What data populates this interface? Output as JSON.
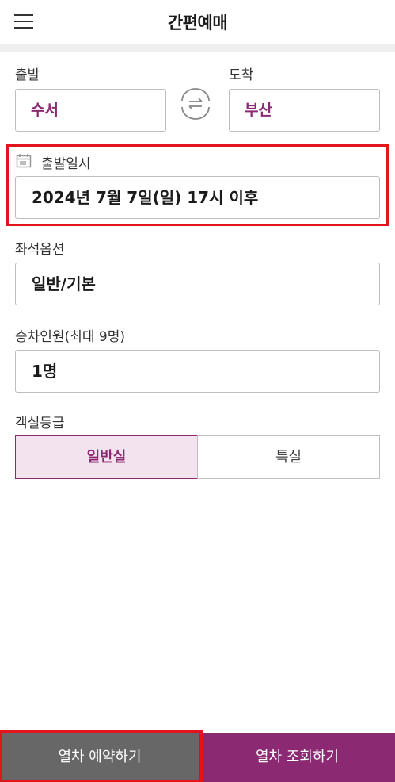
{
  "header": {
    "title": "간편예매",
    "menu_icon": "hamburger-menu-icon"
  },
  "departure": {
    "label": "출발",
    "value": "수서"
  },
  "arrival": {
    "label": "도착",
    "value": "부산"
  },
  "swap_icon": "swap-arrows-icon",
  "datetime": {
    "label": "출발일시",
    "icon": "calendar-icon",
    "value": "2024년 7월 7일(일) 17시 이후"
  },
  "seat_option": {
    "label": "좌석옵션",
    "value": "일반/기본"
  },
  "passengers": {
    "label": "승차인원(최대 9명)",
    "value": "1명"
  },
  "seat_class": {
    "label": "객실등급",
    "options": [
      "일반실",
      "특실"
    ],
    "selected": "일반실"
  },
  "footer": {
    "book_button": "열차 예약하기",
    "search_button": "열차 조회하기"
  },
  "colors": {
    "accent": "#8b2a72",
    "accent_light": "#f3e3ee",
    "highlight": "#e3141e",
    "book_button_bg": "#676767"
  }
}
